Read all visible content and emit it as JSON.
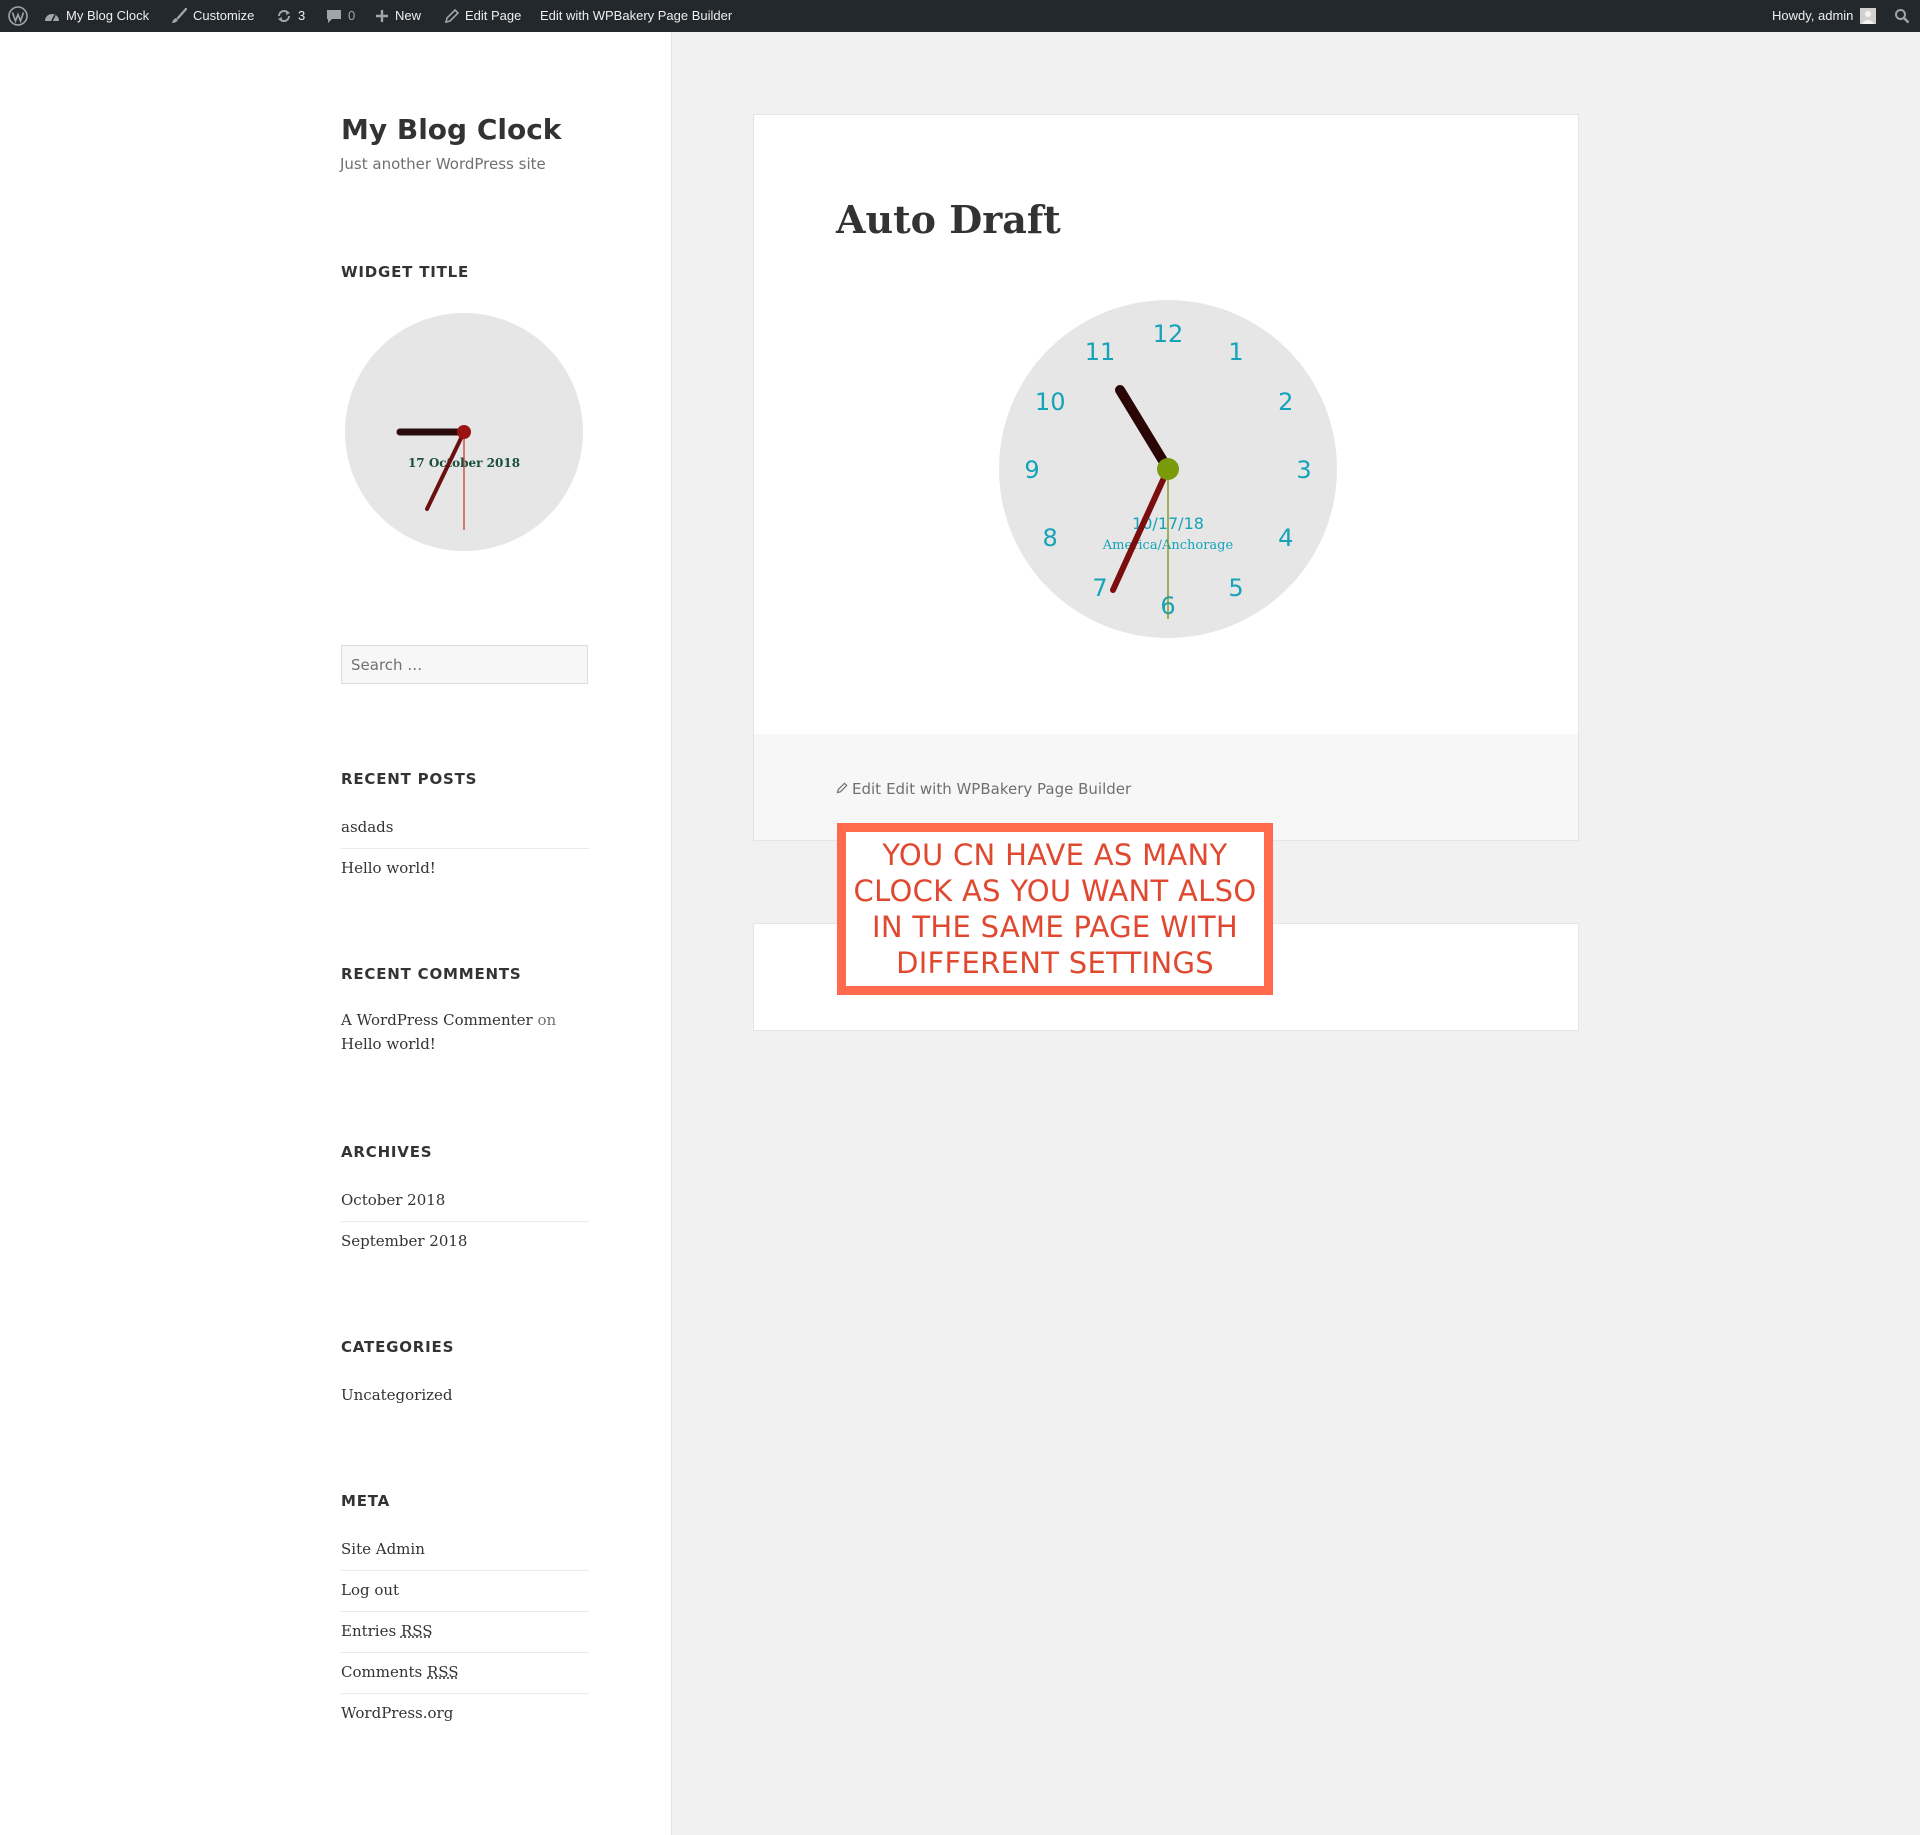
{
  "admin_bar": {
    "site_name": "My Blog Clock",
    "customize": "Customize",
    "updates_count": "3",
    "comments_count": "0",
    "new": "New",
    "edit_page": "Edit Page",
    "edit_with_builder": "Edit with WPBakery Page Builder",
    "howdy": "Howdy, admin"
  },
  "sidebar": {
    "site_title": "My Blog Clock",
    "site_description": "Just another WordPress site",
    "clock_widget": {
      "title": "WIDGET TITLE",
      "date": "17 October 2018"
    },
    "search": {
      "placeholder": "Search …"
    },
    "recent_posts": {
      "title": "RECENT POSTS",
      "items": [
        "asdads",
        "Hello world!"
      ]
    },
    "recent_comments": {
      "title": "RECENT COMMENTS",
      "author": "A WordPress Commenter",
      "connector": "on",
      "post": "Hello world!"
    },
    "archives": {
      "title": "ARCHIVES",
      "items": [
        "October 2018",
        "September 2018"
      ]
    },
    "categories": {
      "title": "CATEGORIES",
      "items": [
        "Uncategorized"
      ]
    },
    "meta": {
      "title": "META",
      "items": [
        "Site Admin",
        "Log out",
        "Entries",
        "Comments",
        "WordPress.org"
      ],
      "rss": "RSS"
    }
  },
  "main": {
    "entry_title": "Auto Draft",
    "clock": {
      "numerals": [
        "12",
        "1",
        "2",
        "3",
        "4",
        "5",
        "6",
        "7",
        "8",
        "9",
        "10",
        "11"
      ],
      "date": "10/17/18",
      "timezone": "America/Anchorage"
    },
    "edit_link": "Edit",
    "edit_builder_link": "Edit with WPBakery Page Builder",
    "callout": "YOU CN HAVE AS MANY CLOCK AS YOU WANT ALSO IN THE SAME PAGE WITH DIFFERENT SETTINGS"
  },
  "colors": {
    "admin_bar_bg": "#23282d",
    "callout_border": "#ff6a4d",
    "callout_text": "#e0482f",
    "clock_numerals": "#14a3b8",
    "clock_face": "#e6e6e6"
  }
}
